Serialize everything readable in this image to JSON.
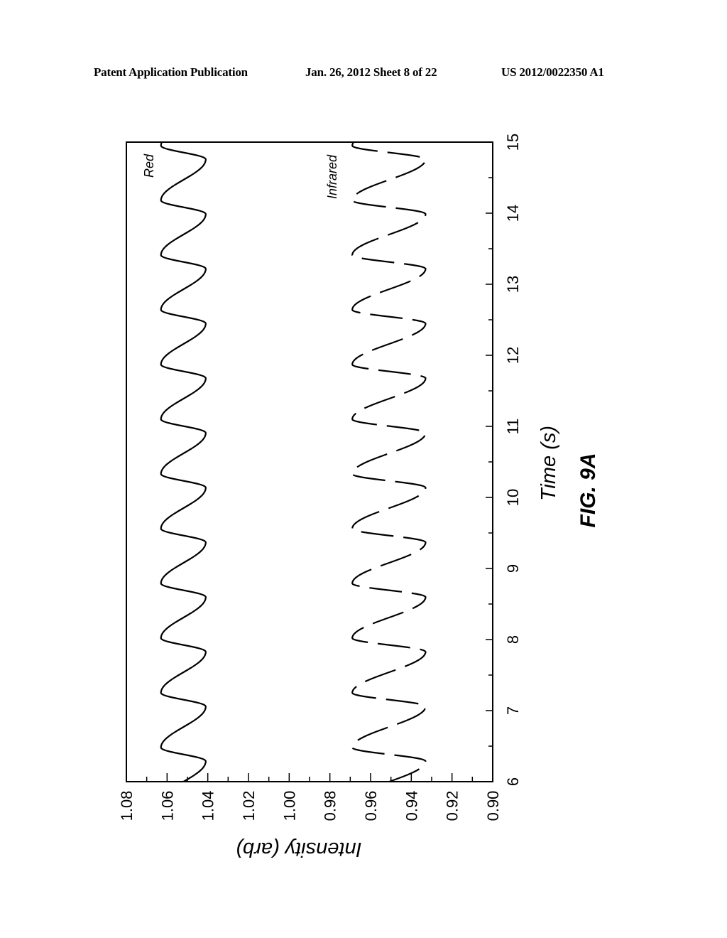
{
  "header": {
    "left": "Patent Application Publication",
    "middle": "Jan. 26, 2012   Sheet 8 of 22",
    "right": "US 2012/0022350 A1"
  },
  "figure_label": "FIG. 9A",
  "chart_data": {
    "type": "line",
    "orientation": "rotated 90 degrees clockwise (time axis vertical)",
    "title": "",
    "xlabel": "Time (s)",
    "ylabel": "Intensity (arb)",
    "xlim": [
      6,
      15
    ],
    "ylim": [
      0.9,
      1.08
    ],
    "x_ticks": [
      "6",
      "7",
      "8",
      "9",
      "10",
      "11",
      "12",
      "13",
      "14",
      "15"
    ],
    "y_ticks": [
      "1.08",
      "1.06",
      "1.04",
      "1.02",
      "1.00",
      "0.98",
      "0.96",
      "0.94",
      "0.92",
      "0.90"
    ],
    "grid": false,
    "series": [
      {
        "name": "Red",
        "style": "solid",
        "mean": 1.052,
        "amplitude": 0.011,
        "period_s": 0.77,
        "first_peak_s": 6.48,
        "peak_value": 1.063,
        "trough_value": 1.041
      },
      {
        "name": "Infrared",
        "style": "dashed",
        "mean": 0.951,
        "amplitude": 0.018,
        "period_s": 0.77,
        "first_peak_s": 6.48,
        "peak_value": 0.969,
        "trough_value": 0.933
      }
    ],
    "annotations": [
      "Red",
      "Infrared"
    ]
  }
}
